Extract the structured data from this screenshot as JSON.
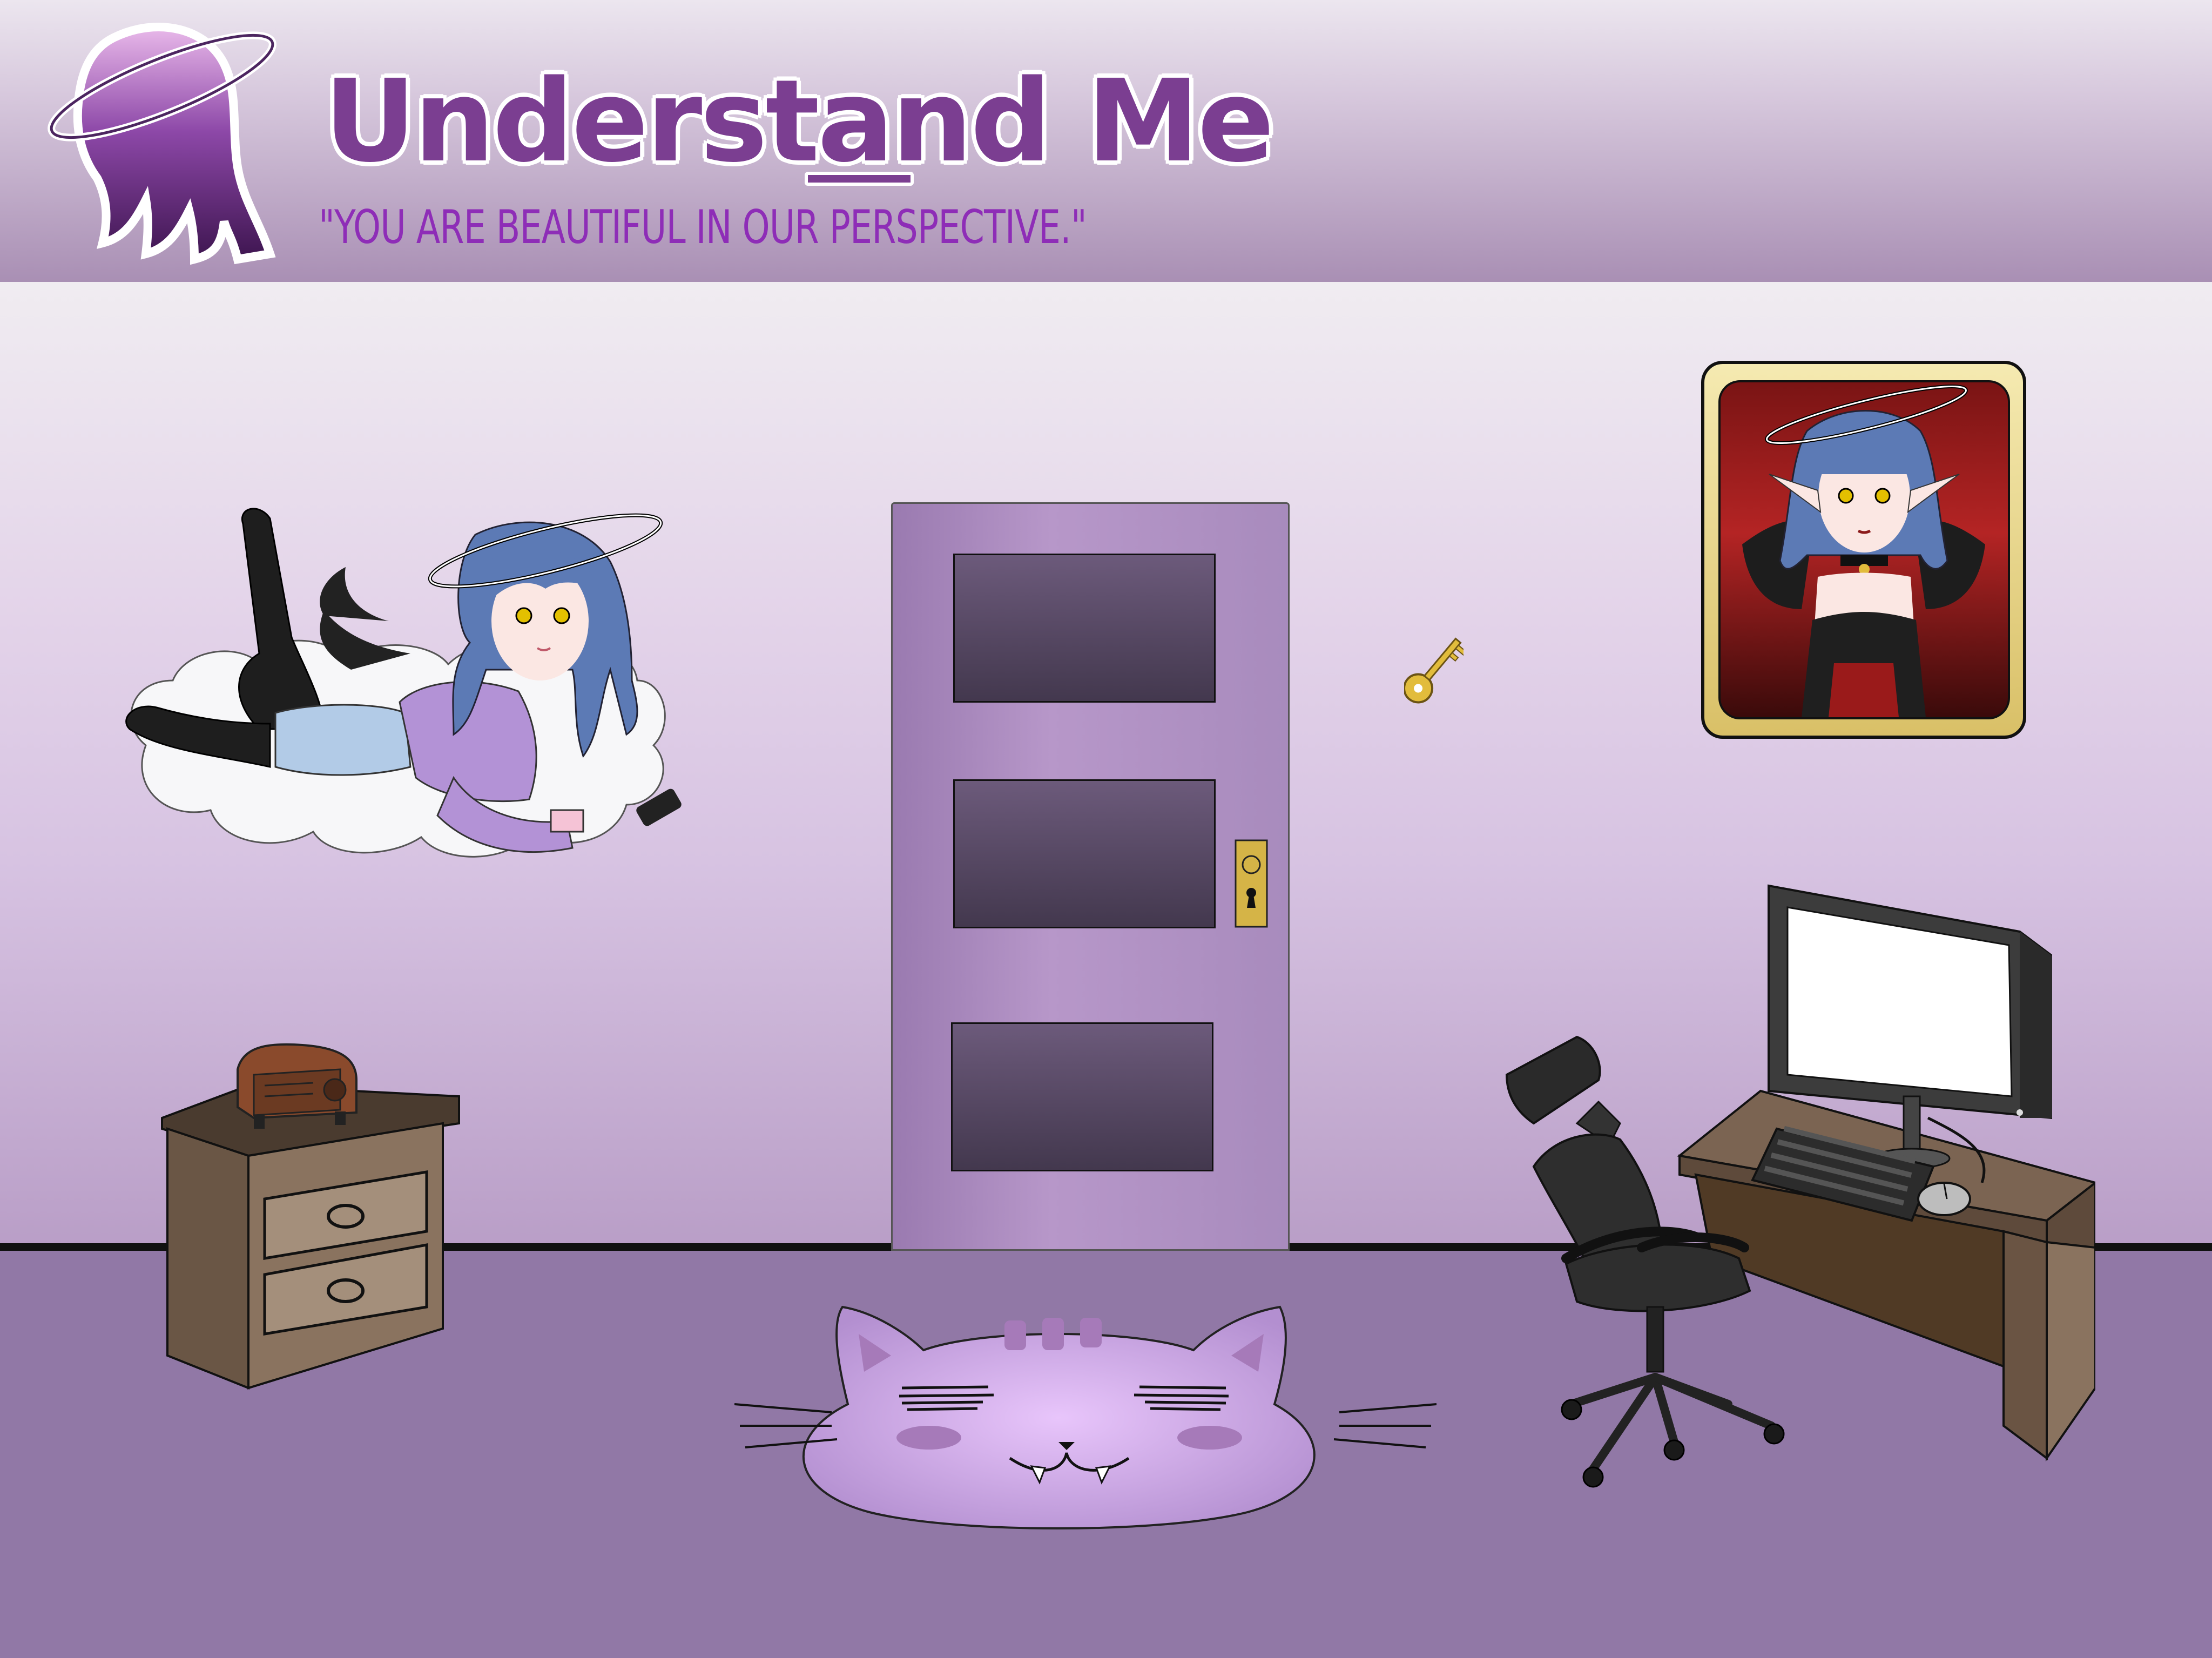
{
  "header": {
    "logo_icon": "hooded-girl-halo-logo",
    "title": "Understand Me",
    "tagline": "\"YOU ARE BEAUTIFUL IN OUR PERSPECTIVE.\""
  },
  "scene": {
    "room": "purple bedroom",
    "colors": {
      "wall_top": "#f0ecf1",
      "wall_bottom": "#b99ec7",
      "floor": "#9178a6",
      "door": "#ad8fc0",
      "accent": "#8e2db7"
    },
    "objects": [
      {
        "name": "girl-on-cloud",
        "icon": "character-icon"
      },
      {
        "name": "door",
        "icon": "door-icon"
      },
      {
        "name": "golden-key",
        "icon": "key-icon"
      },
      {
        "name": "framed-portrait",
        "icon": "portrait-icon"
      },
      {
        "name": "nightstand",
        "icon": "nightstand-icon"
      },
      {
        "name": "radio",
        "icon": "radio-icon"
      },
      {
        "name": "cat-rug",
        "icon": "cat-icon"
      },
      {
        "name": "office-chair",
        "icon": "chair-icon"
      },
      {
        "name": "computer-desk",
        "icon": "desk-icon"
      },
      {
        "name": "computer-monitor",
        "icon": "monitor-icon"
      },
      {
        "name": "keyboard",
        "icon": "keyboard-icon"
      },
      {
        "name": "mouse",
        "icon": "mouse-icon"
      }
    ]
  }
}
